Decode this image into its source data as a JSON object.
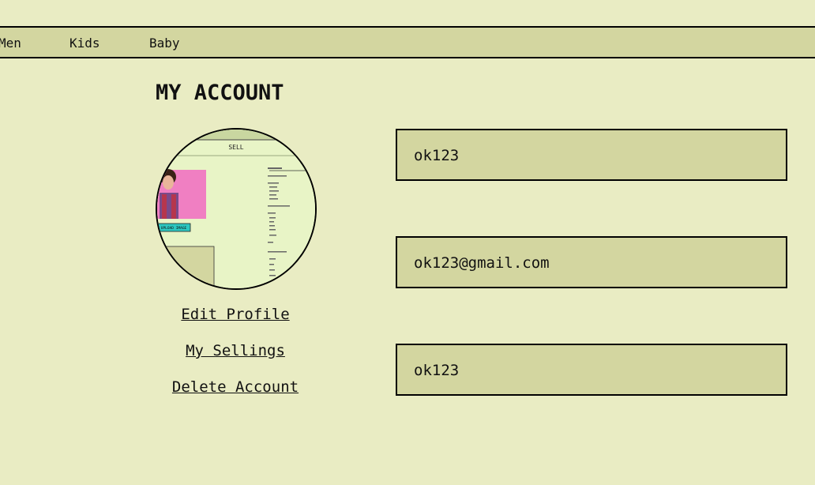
{
  "nav": {
    "items": [
      "Men",
      "Kids",
      "Baby"
    ]
  },
  "page_title": "MY ACCOUNT",
  "avatar": {
    "thumb_header": "SELL",
    "thumb_button": "UPLOAD IMAGE"
  },
  "links": {
    "edit_profile": "Edit Profile",
    "my_sellings": "My Sellings",
    "delete_account": "Delete Account"
  },
  "fields": {
    "username": "ok123",
    "email": "ok123@gmail.com",
    "password": "ok123"
  },
  "colors": {
    "background": "#e9ecc3",
    "panel": "#d3d6a0",
    "border": "#000000"
  }
}
